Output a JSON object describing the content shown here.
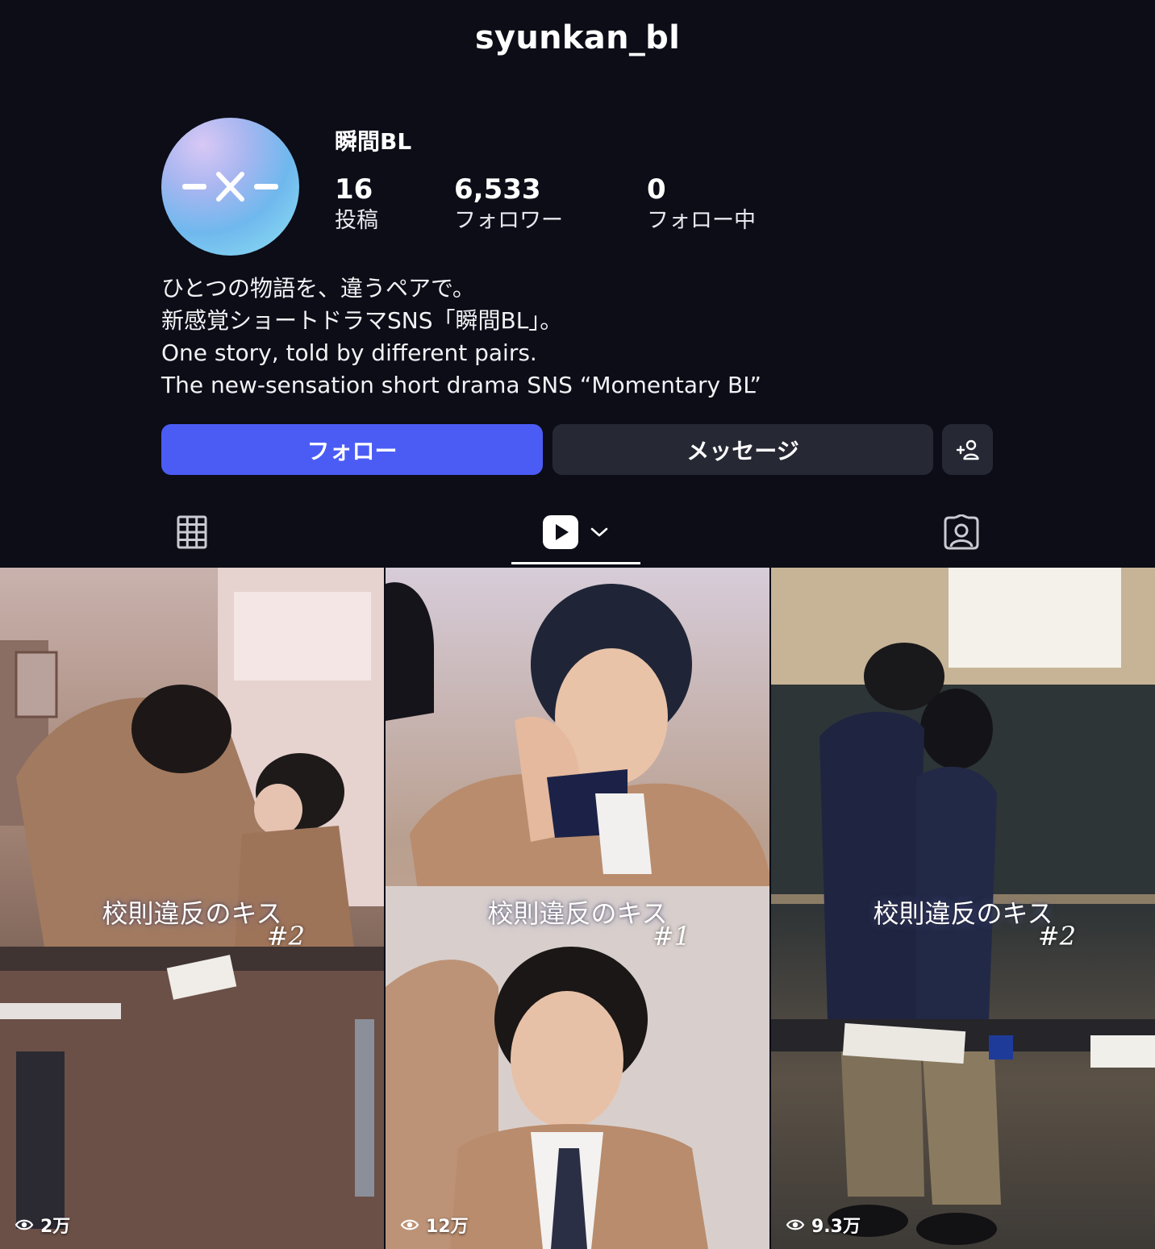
{
  "header": {
    "username": "syunkan_bl"
  },
  "profile": {
    "display_name": "瞬間BL",
    "avatar_mark": "-×-",
    "stats": [
      {
        "value": "16",
        "label": "投稿"
      },
      {
        "value": "6,533",
        "label": "フォロワー"
      },
      {
        "value": "0",
        "label": "フォロー中"
      }
    ],
    "bio": [
      "ひとつの物語を、違うペアで。",
      "新感覚ショートドラマSNS「瞬間BL」。",
      "One story, told by different pairs.",
      "The new-sensation short drama SNS “Momentary BL”"
    ]
  },
  "actions": {
    "follow_label": "フォロー",
    "message_label": "メッセージ"
  },
  "tabs": [
    {
      "icon": "grid-icon"
    },
    {
      "icon": "reels-play-icon",
      "active": true
    },
    {
      "icon": "tagged-person-icon"
    }
  ],
  "reels": [
    {
      "title": "校則違反のキス",
      "episode": "#2",
      "views": "2万"
    },
    {
      "title": "校則違反のキス",
      "episode": "#1",
      "views": "12万"
    },
    {
      "title": "校則違反のキス",
      "episode": "#2",
      "views": "9.3万"
    }
  ],
  "colors": {
    "background": "#0c0d17",
    "follow_button": "#4b5cf5",
    "secondary_button": "#262934"
  }
}
